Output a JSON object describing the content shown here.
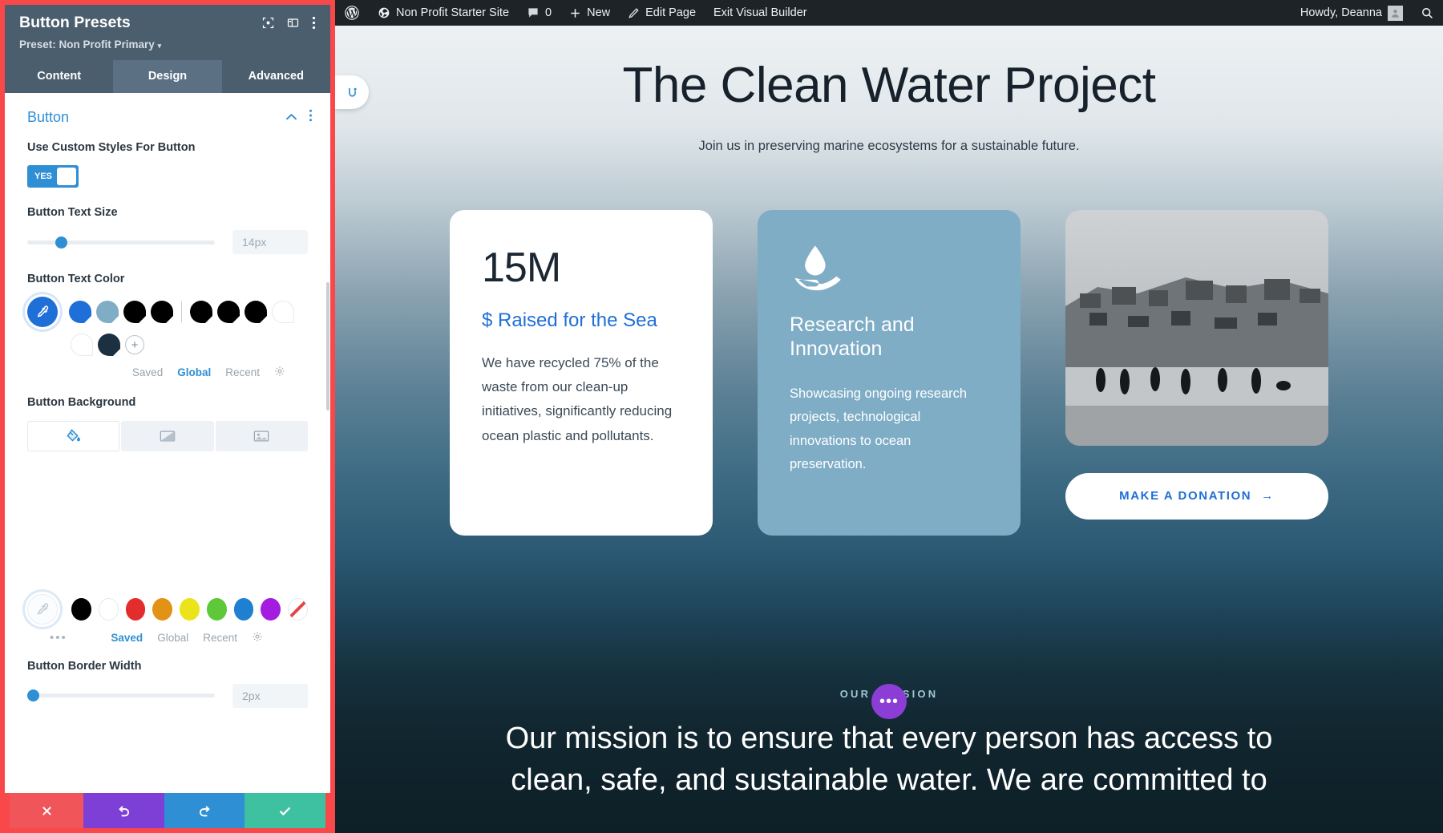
{
  "adminbar": {
    "logo_icon": "wordpress-logo-icon",
    "site_icon": "dashboard-icon",
    "site_name": "Non Profit Starter Site",
    "comments_icon": "comment-bubble-icon",
    "comments_count": "0",
    "new_icon": "plus-icon",
    "new_label": "New",
    "edit_icon": "pencil-icon",
    "edit_label": "Edit Page",
    "exit_label": "Exit Visual Builder",
    "howdy": "Howdy, Deanna",
    "avatar_icon": "user-avatar-icon",
    "search_icon": "search-icon"
  },
  "modal": {
    "title": "Button Presets",
    "preset_prefix": "Preset:",
    "preset_name": "Non Profit Primary",
    "caret": "▾",
    "icons": [
      {
        "name": "fullscreen-icon"
      },
      {
        "name": "layout-columns-icon"
      },
      {
        "name": "more-vertical-icon"
      }
    ],
    "tabs": [
      {
        "label": "Content",
        "active": false
      },
      {
        "label": "Design",
        "active": true
      },
      {
        "label": "Advanced",
        "active": false
      }
    ],
    "section": {
      "title": "Button",
      "collapse_icon": "chevron-up-icon",
      "more_icon": "more-vertical-icon"
    },
    "fields": {
      "custom_styles": {
        "label": "Use Custom Styles For Button",
        "toggle_value": "YES",
        "toggle_on": true
      },
      "text_size": {
        "label": "Button Text Size",
        "value": "14px",
        "slider_percent": 15
      },
      "text_color": {
        "label": "Button Text Color",
        "picker_icon": "eyedropper-icon",
        "swatches": [
          "#1f6fd8",
          "#7fadc6",
          "#000000",
          "#000000",
          "#000000",
          "#000000",
          "#000000",
          "#ffffff",
          "#ffffff",
          "#1b3040"
        ],
        "add_label": "+",
        "palette_tabs": [
          {
            "label": "Saved",
            "active": false
          },
          {
            "label": "Global",
            "active": true
          },
          {
            "label": "Recent",
            "active": false
          }
        ],
        "settings_icon": "gear-icon"
      },
      "background": {
        "label": "Button Background",
        "types": [
          {
            "name": "paint-bucket-icon",
            "active": true
          },
          {
            "name": "gradient-icon",
            "active": false
          },
          {
            "name": "image-icon",
            "active": false
          }
        ],
        "picker_icon": "eyedropper-icon",
        "palette": [
          "#000000",
          "#ffffff",
          "#e32c2c",
          "#e29215",
          "#ece41a",
          "#5ec83a",
          "#1f7fd0",
          "#a41ce0"
        ],
        "transparent_label": "transparent-swatch",
        "more_dots": "•••",
        "palette_tabs": [
          {
            "label": "Saved",
            "active": true
          },
          {
            "label": "Global",
            "active": false
          },
          {
            "label": "Recent",
            "active": false
          }
        ],
        "settings_icon": "gear-icon"
      },
      "border_width": {
        "label": "Button Border Width",
        "value": "2px",
        "slider_percent": 2
      }
    },
    "footer": [
      {
        "name": "cancel-button",
        "icon": "close-x-icon"
      },
      {
        "name": "undo-button",
        "icon": "undo-arrow-icon"
      },
      {
        "name": "redo-button",
        "icon": "redo-arrow-icon"
      },
      {
        "name": "save-button",
        "icon": "checkmark-icon"
      }
    ]
  },
  "site": {
    "side_tab_icon": "divi-tab-icon",
    "hero_title": "The Clean Water Project",
    "hero_subtitle": "Join us in preserving marine ecosystems for a sustainable future.",
    "cards": {
      "stat": {
        "number": "15M",
        "label": "$ Raised for the Sea",
        "body": "We have recycled 75% of the waste from our clean-up initiatives, significantly reducing ocean plastic and pollutants."
      },
      "research": {
        "icon": "water-drop-hand-icon",
        "title": "Research and Innovation",
        "body": "Showcasing ongoing research projects, technological innovations to ocean preservation."
      },
      "right": {
        "photo_alt": "coastal-village-photo",
        "donate_label": "MAKE A DONATION",
        "donate_arrow": "→"
      }
    },
    "mission_eyebrow": "OUR MISSION",
    "mission_text": "Our mission is to ensure that every person has access to clean, safe, and sustainable water. We are committed to",
    "fab_icon": "more-dots-icon",
    "fab_label": "•••"
  }
}
